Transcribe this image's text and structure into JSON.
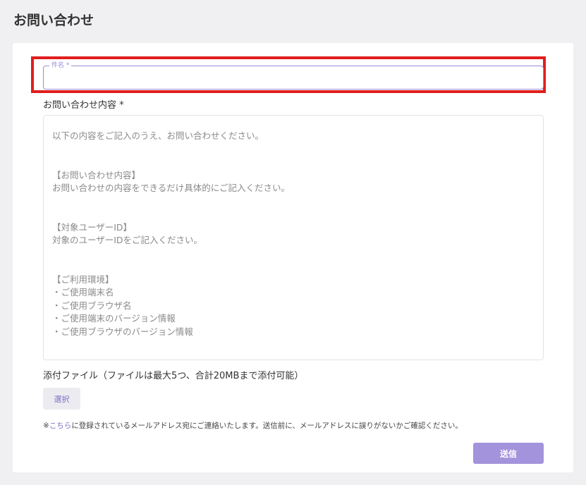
{
  "page": {
    "title": "お問い合わせ"
  },
  "form": {
    "subject": {
      "label": "件名 *",
      "value": ""
    },
    "content": {
      "label": "お問い合わせ内容 *",
      "value": "以下の内容をご記入のうえ、お問い合わせください。\n\n\n【お問い合わせ内容】\nお問い合わせの内容をできるだけ具体的にご記入ください。\n\n\n【対象ユーザーID】\n対象のユーザーIDをご記入ください。\n\n\n【ご利用環境】\n・ご使用端末名\n・ご使用ブラウザ名\n・ご使用端末のバージョン情報\n・ご使用ブラウザのバージョン情報"
    },
    "attachment": {
      "label": "添付ファイル（ファイルは最大5つ、合計20MBまで添付可能）",
      "select_label": "選択"
    },
    "notice": {
      "prefix": "※",
      "link_text": "こちら",
      "suffix": "に登録されているメールアドレス宛にご連絡いたします。送信前に、メールアドレスに誤りがないかご確認ください。"
    },
    "submit_label": "送信"
  },
  "colors": {
    "accent": "#9b8bd9",
    "submit_bg": "#a393dc",
    "highlight": "#e01e1e",
    "background": "#f0f0f3"
  }
}
